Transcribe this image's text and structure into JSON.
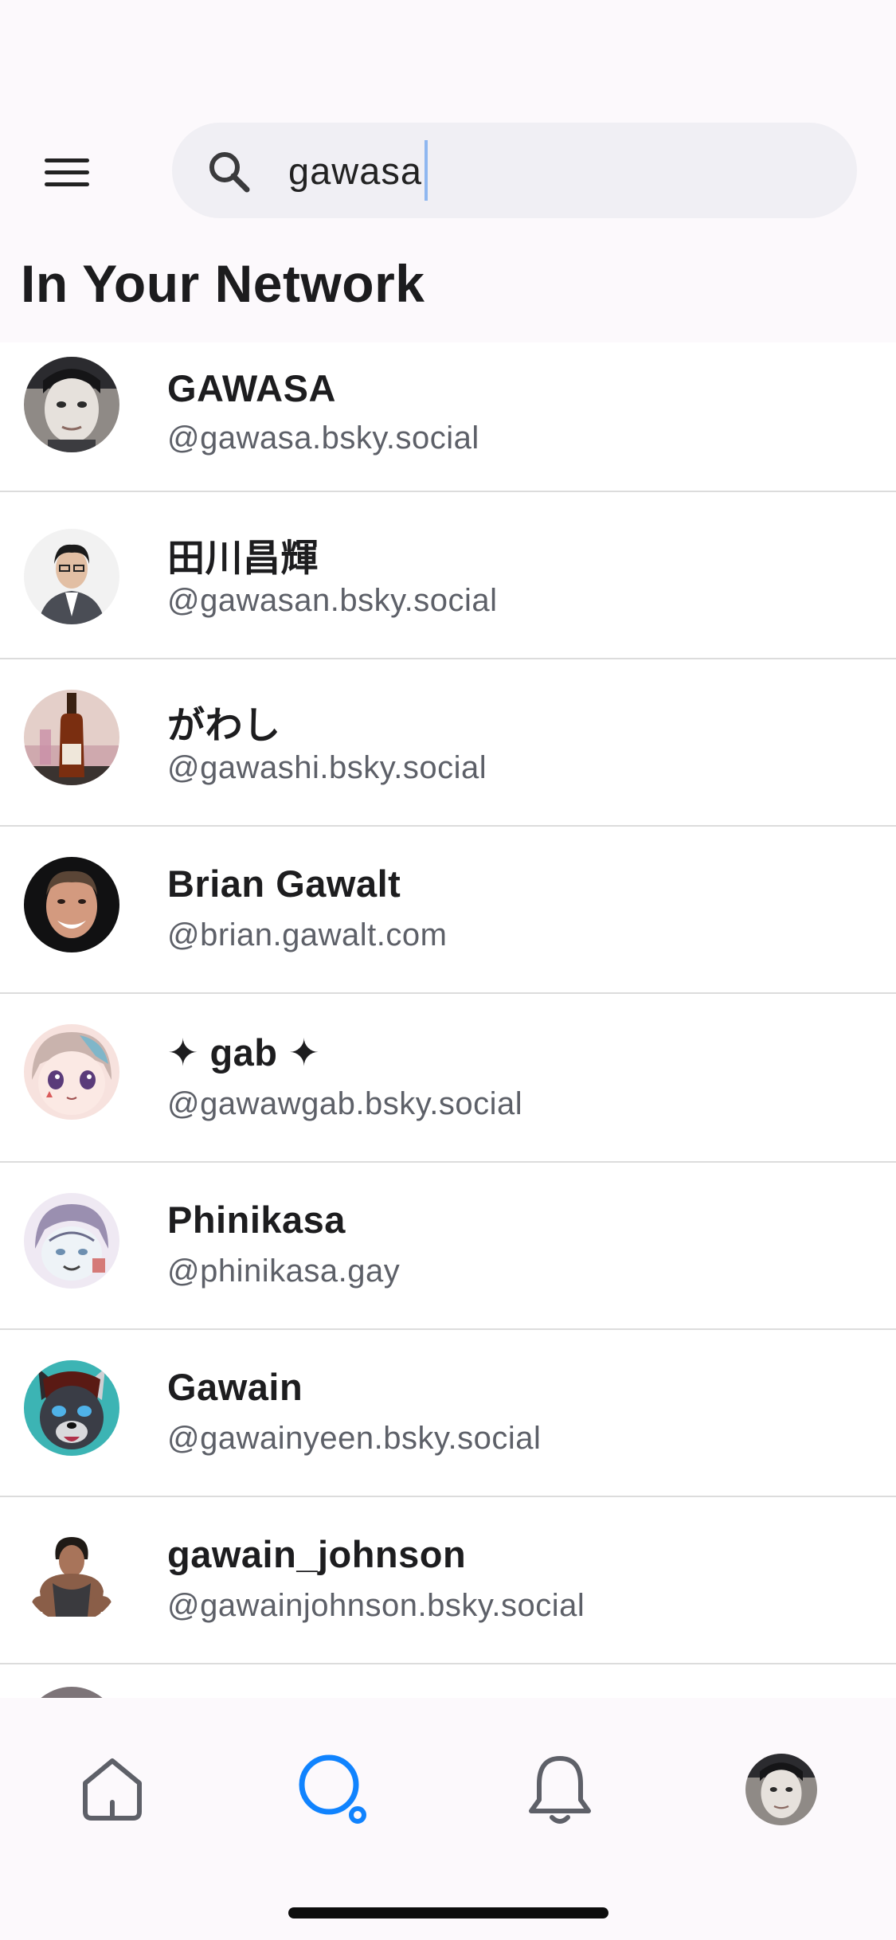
{
  "search": {
    "query": "gawasa"
  },
  "section": {
    "title": "In Your Network"
  },
  "results": [
    {
      "name": "GAWASA",
      "handle": "@gawasa.bsky.social",
      "avatar": "face-mask-avatar"
    },
    {
      "name": "田川昌輝",
      "handle": "@gawasan.bsky.social",
      "avatar": "suited-man-avatar"
    },
    {
      "name": "がわし",
      "handle": "@gawashi.bsky.social",
      "avatar": "bottle-avatar"
    },
    {
      "name": "Brian Gawalt",
      "handle": "@brian.gawalt.com",
      "avatar": "smiling-man-avatar"
    },
    {
      "name": "✦ gab ✦",
      "handle": "@gawawgab.bsky.social",
      "avatar": "anime-girl-avatar"
    },
    {
      "name": "Phinikasa",
      "handle": "@phinikasa.gay",
      "avatar": "sketch-character-avatar"
    },
    {
      "name": "Gawain",
      "handle": "@gawainyeen.bsky.social",
      "avatar": "wolf-avatar"
    },
    {
      "name": "gawain_johnson",
      "handle": "@gawainjohnson.bsky.social",
      "avatar": "muscle-man-avatar"
    }
  ],
  "tabbar": {
    "items": [
      {
        "icon": "home-icon"
      },
      {
        "icon": "search-icon",
        "active": true
      },
      {
        "icon": "bell-icon"
      },
      {
        "icon": "profile-avatar"
      }
    ],
    "active_color": "#1083fe"
  }
}
